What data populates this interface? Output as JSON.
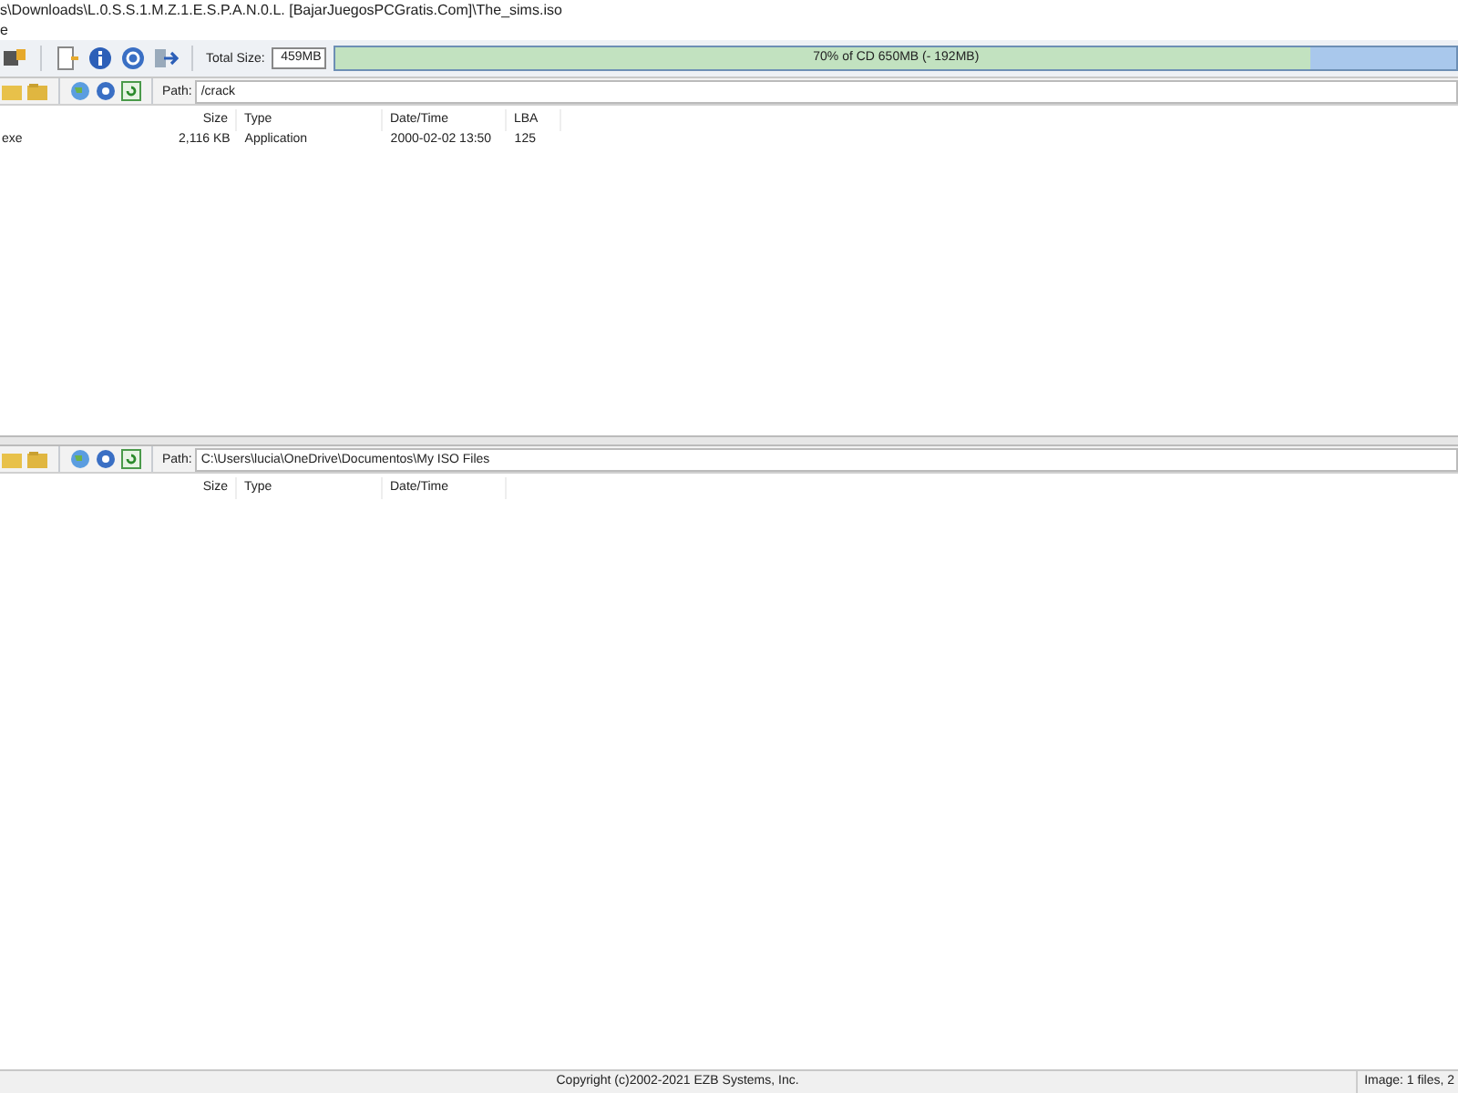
{
  "window": {
    "title": "s\\Downloads\\L.0.S.S.1.M.Z.1.E.S.P.A.N.0.L. [BajarJuegosPCGratis.Com]\\The_sims.iso"
  },
  "menu": {
    "items": [
      "e"
    ]
  },
  "toolbar": {
    "total_size_label": "Total Size:",
    "total_size_value": "459MB",
    "capacity": {
      "level": 0.87,
      "reading": "70% of CD 650MB (- 192MB)"
    }
  },
  "image_pane": {
    "path_label": "Path:",
    "path": "/crack",
    "columns": [
      "Size",
      "Type",
      "Date/Time",
      "LBA"
    ],
    "rows": [
      {
        "name": "exe",
        "size": "2,116 KB",
        "type": "Application",
        "date": "2000-02-02 13:50",
        "lba": "125"
      }
    ]
  },
  "local_pane": {
    "path_label": "Path:",
    "path": "C:\\Users\\lucia\\OneDrive\\Documentos\\My ISO Files",
    "columns": [
      "Size",
      "Type",
      "Date/Time"
    ]
  },
  "status_bar": {
    "copyright": "Copyright (c)2002-2021 EZB Systems, Inc.",
    "image_info": "Image: 1 files, 2"
  }
}
